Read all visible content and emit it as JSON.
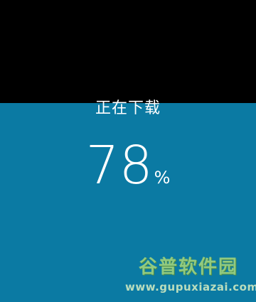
{
  "download": {
    "status_label": "正在下载",
    "progress_value": "78",
    "progress_unit": "%",
    "progress_fraction": 0.66
  },
  "colors": {
    "fill": "#0b7aa3",
    "background": "#000000",
    "text": "#ffffff"
  },
  "watermark": {
    "title": "谷普软件园",
    "url": "www.gupuxiazai.com"
  }
}
